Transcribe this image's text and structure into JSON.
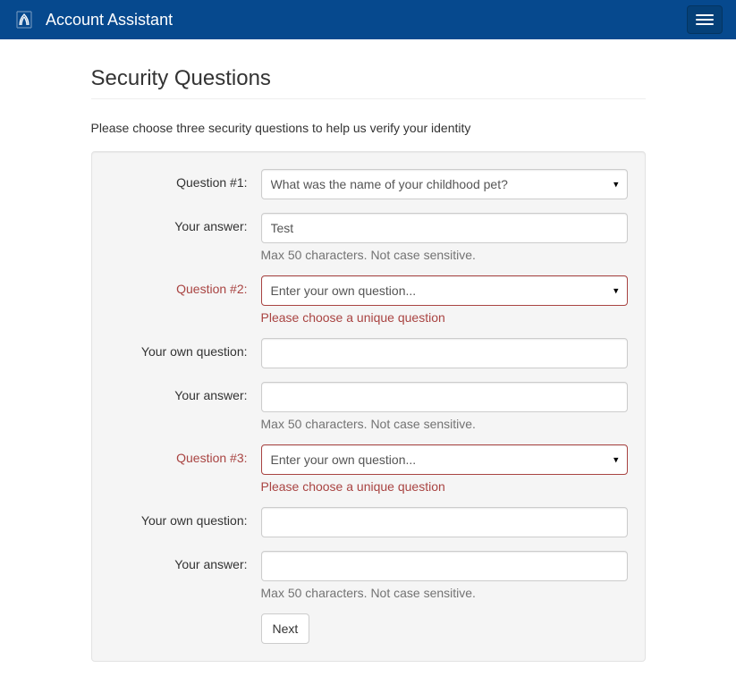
{
  "navbar": {
    "brand": "Account Assistant"
  },
  "page": {
    "title": "Security Questions",
    "instructions": "Please choose three security questions to help us verify your identity"
  },
  "form": {
    "answer_help": "Max 50 characters. Not case sensitive.",
    "error_unique": "Please choose a unique question",
    "own_question_label": "Your own question:",
    "answer_label": "Your answer:",
    "next_label": "Next",
    "q1": {
      "label": "Question #1:",
      "selected": "What was the name of your childhood pet?",
      "answer": "Test"
    },
    "q2": {
      "label": "Question #2:",
      "selected": "Enter your own question...",
      "own_question": "",
      "answer": ""
    },
    "q3": {
      "label": "Question #3:",
      "selected": "Enter your own question...",
      "own_question": "",
      "answer": ""
    }
  }
}
